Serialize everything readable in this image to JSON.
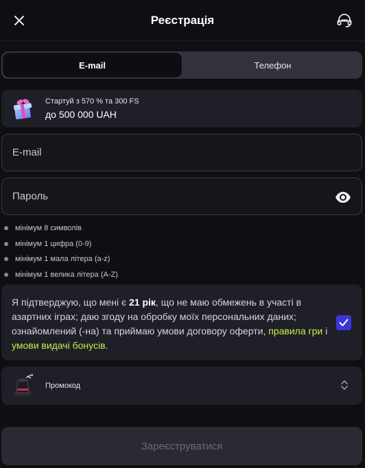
{
  "header": {
    "title": "Реєстрація",
    "close_icon": "close-icon",
    "support_icon": "headset-icon"
  },
  "tabs": [
    {
      "label": "E-mail",
      "active": true
    },
    {
      "label": "Телефон",
      "active": false
    }
  ],
  "bonus": {
    "icon": "gift-icon",
    "line1": "Стартуй з 570 % та 300 FS",
    "line2": "до 500 000 UAH"
  },
  "email_field": {
    "placeholder": "E-mail",
    "value": ""
  },
  "password_field": {
    "placeholder": "Пароль",
    "value": "",
    "icon": "eye-icon"
  },
  "password_rules": [
    "мінімум 8 символів",
    "мінімум 1 цифра (0-9)",
    "мінімум 1 мала літера (a-z)",
    "мінімум 1 велика літера (A-Z)"
  ],
  "consent": {
    "text_before": "Я підтверджую, що мені є ",
    "age": "21 рік",
    "text_middle": ", що не маю обмежень в участі в азартних іграх; даю згоду на обробку моїх персональних даних; ознайомлений (-на) та приймаю умови договору оферти, ",
    "link_rules": "правила гри",
    "text_and": " і ",
    "link_bonus": "умови видачі бонусів",
    "text_end": ".",
    "checked": true
  },
  "promo": {
    "icon": "magic-hat-icon",
    "label": "Промокод",
    "chevron_icon": "chevron-up-down-icon"
  },
  "submit": {
    "label": "Зареєструватися"
  },
  "colors": {
    "background": "#0e0e13",
    "panel": "#1f1f28",
    "accent_link": "#c7f046",
    "checkbox": "#3b35d6",
    "submit_disabled": "#2a2a33"
  }
}
